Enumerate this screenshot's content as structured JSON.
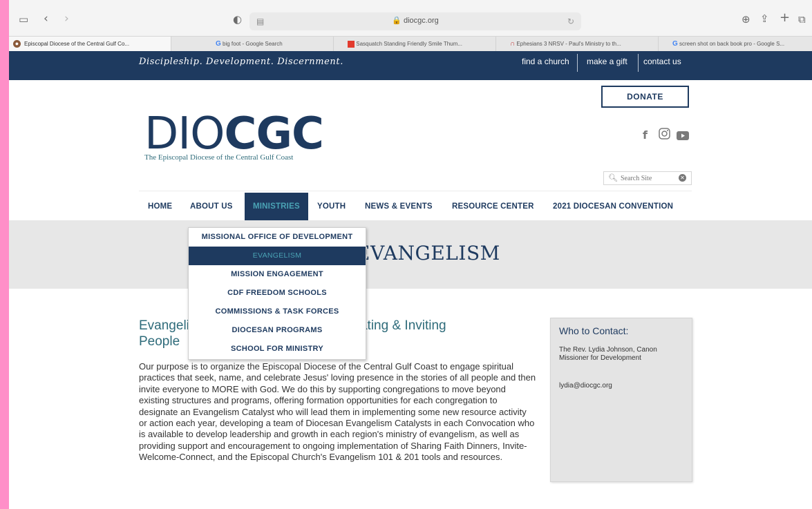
{
  "browser": {
    "url": "diocgc.org",
    "tabs": [
      {
        "title": "Episcopal Diocese of the Central Gulf Co...",
        "favicon": "globe-icon"
      },
      {
        "title": "big foot - Google Search",
        "favicon": "G"
      },
      {
        "title": "Sasquatch Standing Friendly Smile Thum...",
        "favicon": "shop-icon"
      },
      {
        "title": "Ephesians 3 NRSV - Paul's Ministry to th...",
        "favicon": "arch-icon"
      },
      {
        "title": "screen shot on back book pro - Google S...",
        "favicon": "G"
      }
    ]
  },
  "topbar": {
    "tagline": "Discipleship. Development. Discernment.",
    "links": [
      "find a church",
      "make a gift",
      "contact us"
    ]
  },
  "header": {
    "donate": "DONATE",
    "logo_part1": "DIO",
    "logo_part2": "CGC",
    "logo_subtitle": "The Episcopal Diocese of the Central Gulf Coast",
    "social": [
      "facebook-icon",
      "instagram-icon",
      "youtube-icon"
    ],
    "search_placeholder": "Search Site"
  },
  "nav": [
    "HOME",
    "ABOUT US",
    "MINISTRIES",
    "YOUTH",
    "NEWS & EVENTS",
    "RESOURCE CENTER",
    "2021 DIOCESAN CONVENTION"
  ],
  "dropdown": [
    "MISSIONAL OFFICE OF DEVELOPMENT",
    "EVANGELISM",
    "MISSION ENGAGEMENT",
    "CDF FREEDOM SCHOOLS",
    "COMMISSIONS & TASK FORCES",
    "DIOCESAN PROGRAMS",
    "SCHOOL FOR MINISTRY"
  ],
  "page": {
    "title": "EVANGELISM",
    "intro_line1": "Evangelism: Seeking, Naming, Celebrating & Inviting",
    "intro_line2": "People",
    "body": "Our purpose is to organize the Episcopal Diocese of the Central Gulf Coast to engage spiritual practices that seek, name, and celebrate Jesus' loving presence in the stories of all people and then invite everyone to MORE with God. We do this by supporting congregations to move beyond existing structures and programs, offering formation opportunities for each congregation to designate an Evangelism Catalyst who will lead them in implementing some new resource activity or action each year, developing a team of Diocesan Evangelism Catalysts in each Convocation who is available to develop leadership and growth in each region's ministry of evangelism, as well as providing support and encouragement to ongoing implementation of Sharing Faith Dinners, Invite-Welcome-Connect, and the Episcopal Church's Evangelism 101 & 201 tools and resources."
  },
  "contact": {
    "title": "Who to Contact:",
    "name": "The Rev. Lydia Johnson, Canon Missioner for Development",
    "email": "lydia@diocgc.org"
  },
  "colors": {
    "navy": "#1e3a5f",
    "teal": "#4aa3b5",
    "intro": "#2e6b7a",
    "background_frame": "#ff8fc8"
  }
}
